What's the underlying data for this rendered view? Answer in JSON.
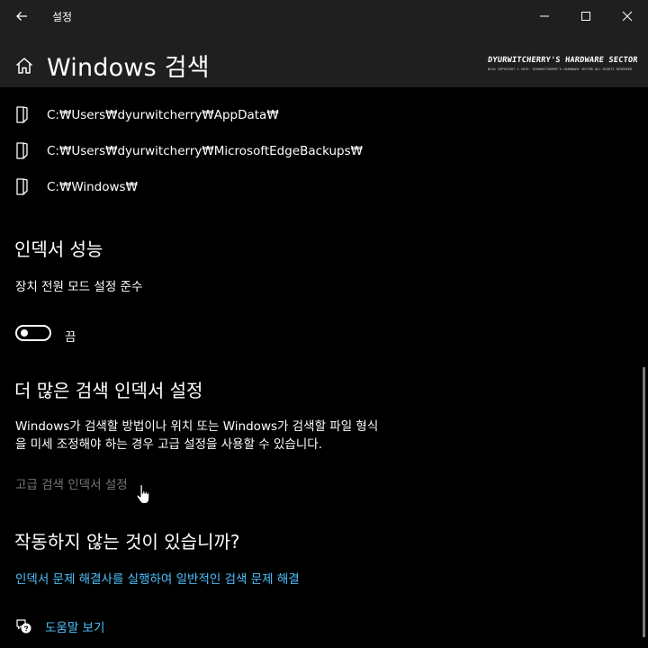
{
  "window": {
    "title": "설정",
    "controls": [
      "minimize-icon",
      "maximize-icon",
      "close-icon"
    ]
  },
  "header": {
    "title": "Windows 검색",
    "watermark_main": "DYURWITCHERRY'S HARDWARE SECTOR",
    "watermark_sub": "BLOG COPYRIGHT © 2019. DYURWITCHERRY'S HARDWARE SECTOR ALL RIGHTS RESERVED."
  },
  "excluded_folders": [
    {
      "path": "C:₩Users₩dyurwitcherry₩AppData₩"
    },
    {
      "path": "C:₩Users₩dyurwitcherry₩MicrosoftEdgeBackups₩"
    },
    {
      "path": "C:₩Windows₩"
    }
  ],
  "indexer_performance": {
    "title": "인덱서 성능",
    "description": "장치 전원 모드 설정 준수",
    "toggle_state": "끔"
  },
  "more_settings": {
    "title": "더 많은 검색 인덱서 설정",
    "description_line1": "Windows가 검색할 방법이나 위치 또는 Windows가 검색할 파일 형식",
    "description_line2": "을 미세 조정해야 하는 경우 고급 설정을 사용할 수 있습니다.",
    "advanced_link": "고급 검색 인덱서 설정"
  },
  "troubleshoot": {
    "title": "작동하지 않는 것이 있습니까?",
    "link": "인덱서 문제 해결사를 실행하여 일반적인 검색 문제 해결"
  },
  "help": {
    "link": "도움말 보기"
  },
  "colors": {
    "background": "#000000",
    "titlebar": "#1f1f1f",
    "accent_link": "#4cc2ff",
    "disabled_text": "#767676"
  }
}
